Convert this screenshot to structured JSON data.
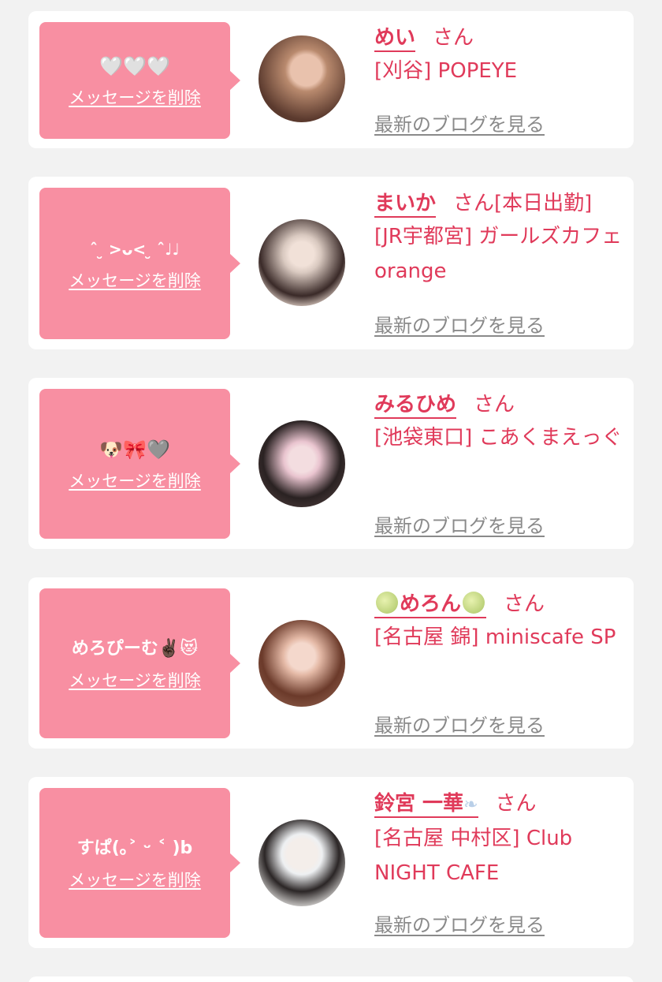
{
  "entries": [
    {
      "message": "🤍🤍🤍",
      "delete_label": "メッセージを削除",
      "name": "めい",
      "honorific": "さん",
      "tag": "",
      "shop": "[刈谷] POPEYE",
      "blog_label": "最新のブログを見る",
      "avatar_colors": [
        "#5b3a2e",
        "#b98a6e"
      ]
    },
    {
      "message": "ˆ ̮ >ᴗ< ̮ ˆ♩♩",
      "delete_label": "メッセージを削除",
      "name": "まいか",
      "honorific": "さん",
      "tag": "[本日出勤]",
      "shop": "[JR宇都宮] ガールズカフェ orange",
      "blog_label": "最新のブログを見る",
      "avatar_colors": [
        "#3a2a28",
        "#d9c9c0"
      ]
    },
    {
      "message": "🐶🎀🩶",
      "delete_label": "メッセージを削除",
      "name": "みるひめ",
      "honorific": "さん",
      "tag": "",
      "shop": "[池袋東口] こあくまえっぐ",
      "blog_label": "最新のブログを見る",
      "avatar_colors": [
        "#2a2222",
        "#e9c4cf"
      ]
    },
    {
      "message": "めろぴーむ✌🏿😻",
      "delete_label": "メッセージを削除",
      "name_prefix": "melon",
      "name": "めろん",
      "name_suffix": "melon",
      "honorific": "さん",
      "tag": "",
      "shop": "[名古屋 錦] miniscafe SP",
      "blog_label": "最新のブログを見る",
      "avatar_colors": [
        "#6b3a2a",
        "#e4b9a6"
      ]
    },
    {
      "message": "すぱ(｡˃ ᵕ ˂ )b",
      "delete_label": "メッセージを削除",
      "name": "鈴宮 一華",
      "name_suffix": "wing",
      "honorific": "さん",
      "tag": "",
      "shop": "[名古屋 中村区] Club NIGHT CAFE",
      "blog_label": "最新のブログを見る",
      "avatar_colors": [
        "#2b2626",
        "#eef0f2"
      ]
    }
  ],
  "icons": {
    "melon": "melon-icon",
    "wing": "wing-icon"
  },
  "colors": {
    "accent": "#e03a5a",
    "bubble": "#f88fa2",
    "link_gray": "#8a8a8a",
    "background": "#f2f2f2"
  }
}
